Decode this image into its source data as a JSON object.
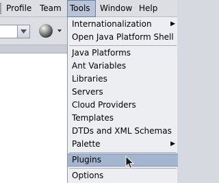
{
  "menubar": {
    "items": [
      {
        "label": "Profile"
      },
      {
        "label": "Team"
      },
      {
        "label": "Tools"
      },
      {
        "label": "Window"
      },
      {
        "label": "Help"
      }
    ]
  },
  "tools_menu": {
    "items": [
      {
        "label": "Internationalization",
        "submenu": true
      },
      {
        "label": "Open Java Platform Shell"
      },
      {
        "label": "Java Platforms"
      },
      {
        "label": "Ant Variables"
      },
      {
        "label": "Libraries"
      },
      {
        "label": "Servers"
      },
      {
        "label": "Cloud Providers"
      },
      {
        "label": "Templates"
      },
      {
        "label": "DTDs and XML Schemas"
      },
      {
        "label": "Palette",
        "submenu": true
      },
      {
        "label": "Plugins",
        "highlighted": true
      },
      {
        "label": "Options"
      }
    ]
  },
  "colors": {
    "highlight": "#a3b5cf",
    "menu_bg": "#eceef1",
    "active_title": "#b7c3d6"
  },
  "icons": {
    "submenu_arrow": "▶",
    "globe": "globe-icon",
    "cursor": "mouse-pointer-icon"
  }
}
